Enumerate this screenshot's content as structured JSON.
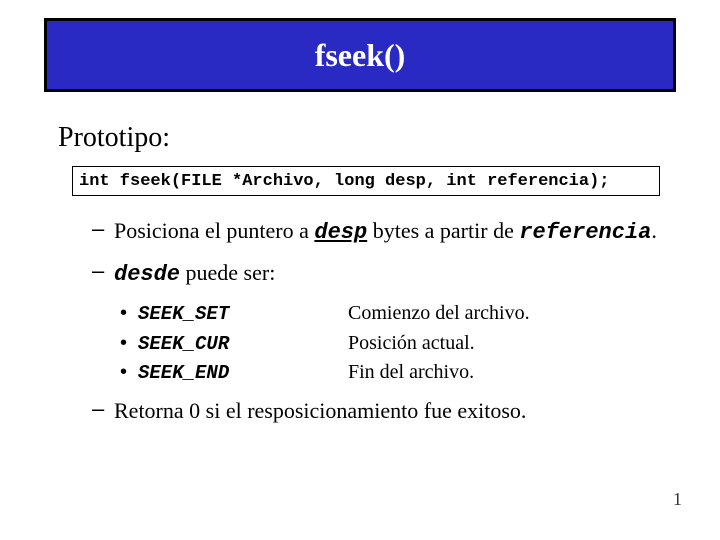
{
  "title": "fseek()",
  "section_label": "Prototipo:",
  "prototype_code": "int fseek(FILE *Archivo, long desp, int referencia);",
  "bullet1": {
    "pre": "Posiciona el puntero  a ",
    "kw1": "desp",
    "mid": " bytes a partir de ",
    "kw2": "referencia",
    "post": "."
  },
  "bullet2": {
    "pre": "",
    "kw1": "desde",
    "post": " puede ser:"
  },
  "constants": [
    {
      "name": "SEEK_SET",
      "desc": "Comienzo del archivo."
    },
    {
      "name": "SEEK_CUR",
      "desc": "Posición actual."
    },
    {
      "name": "SEEK_END",
      "desc": "Fin del archivo."
    }
  ],
  "bullet3": "Retorna 0 si el resposicionamiento fue exitoso.",
  "page_number": "1"
}
